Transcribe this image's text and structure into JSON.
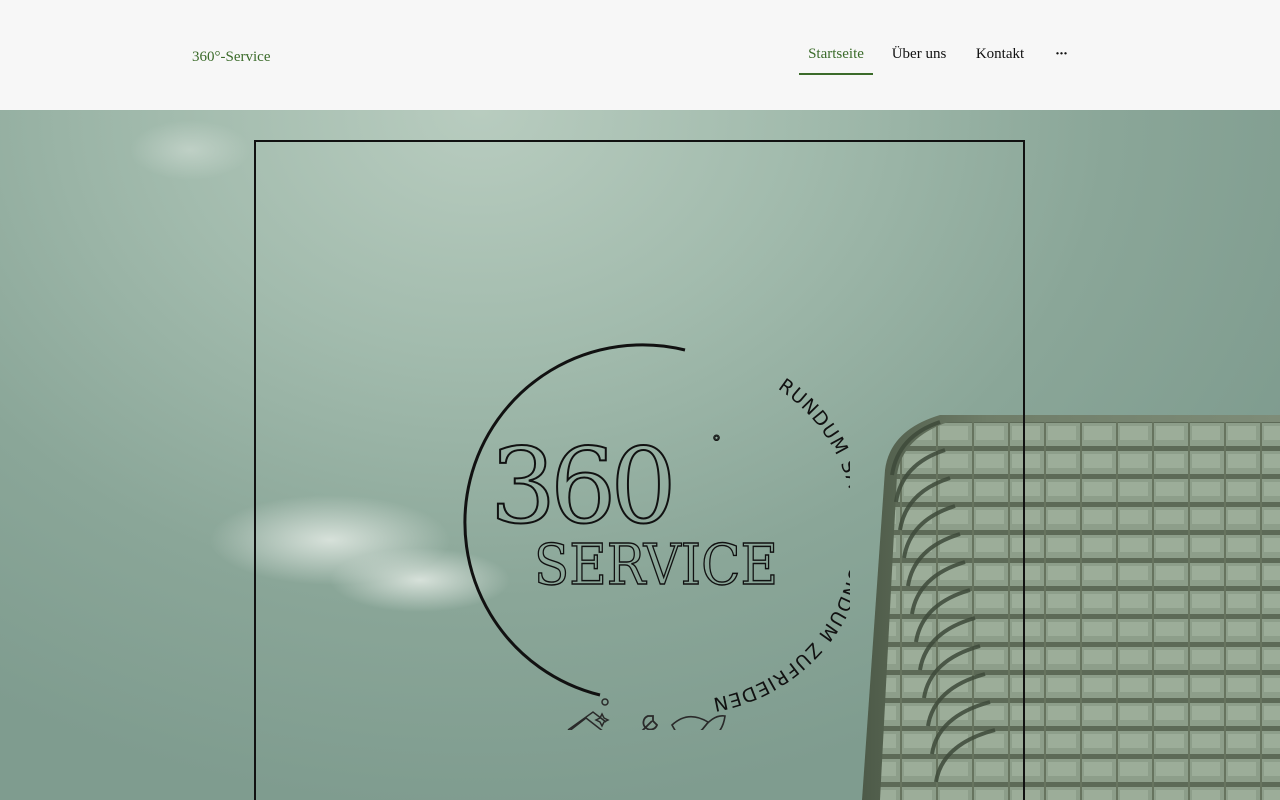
{
  "header": {
    "site_title": "360°-Service",
    "nav": [
      {
        "label": "Startseite",
        "active": true
      },
      {
        "label": "Über uns",
        "active": false
      },
      {
        "label": "Kontakt",
        "active": false
      },
      {
        "label": "···",
        "active": false
      }
    ]
  },
  "logo": {
    "number": "360",
    "degree_sign": "°",
    "word": "SERVICE",
    "tagline": "RUNDUM SAUBER-RUNDUM ZUFRIEDEN",
    "icons": [
      "house-sparkle-icon",
      "wrench-icon",
      "leaf-icon"
    ]
  },
  "colors": {
    "accent": "#3b6b2a",
    "header_bg": "#f7f7f7",
    "hero_tint": "#8aa698"
  }
}
